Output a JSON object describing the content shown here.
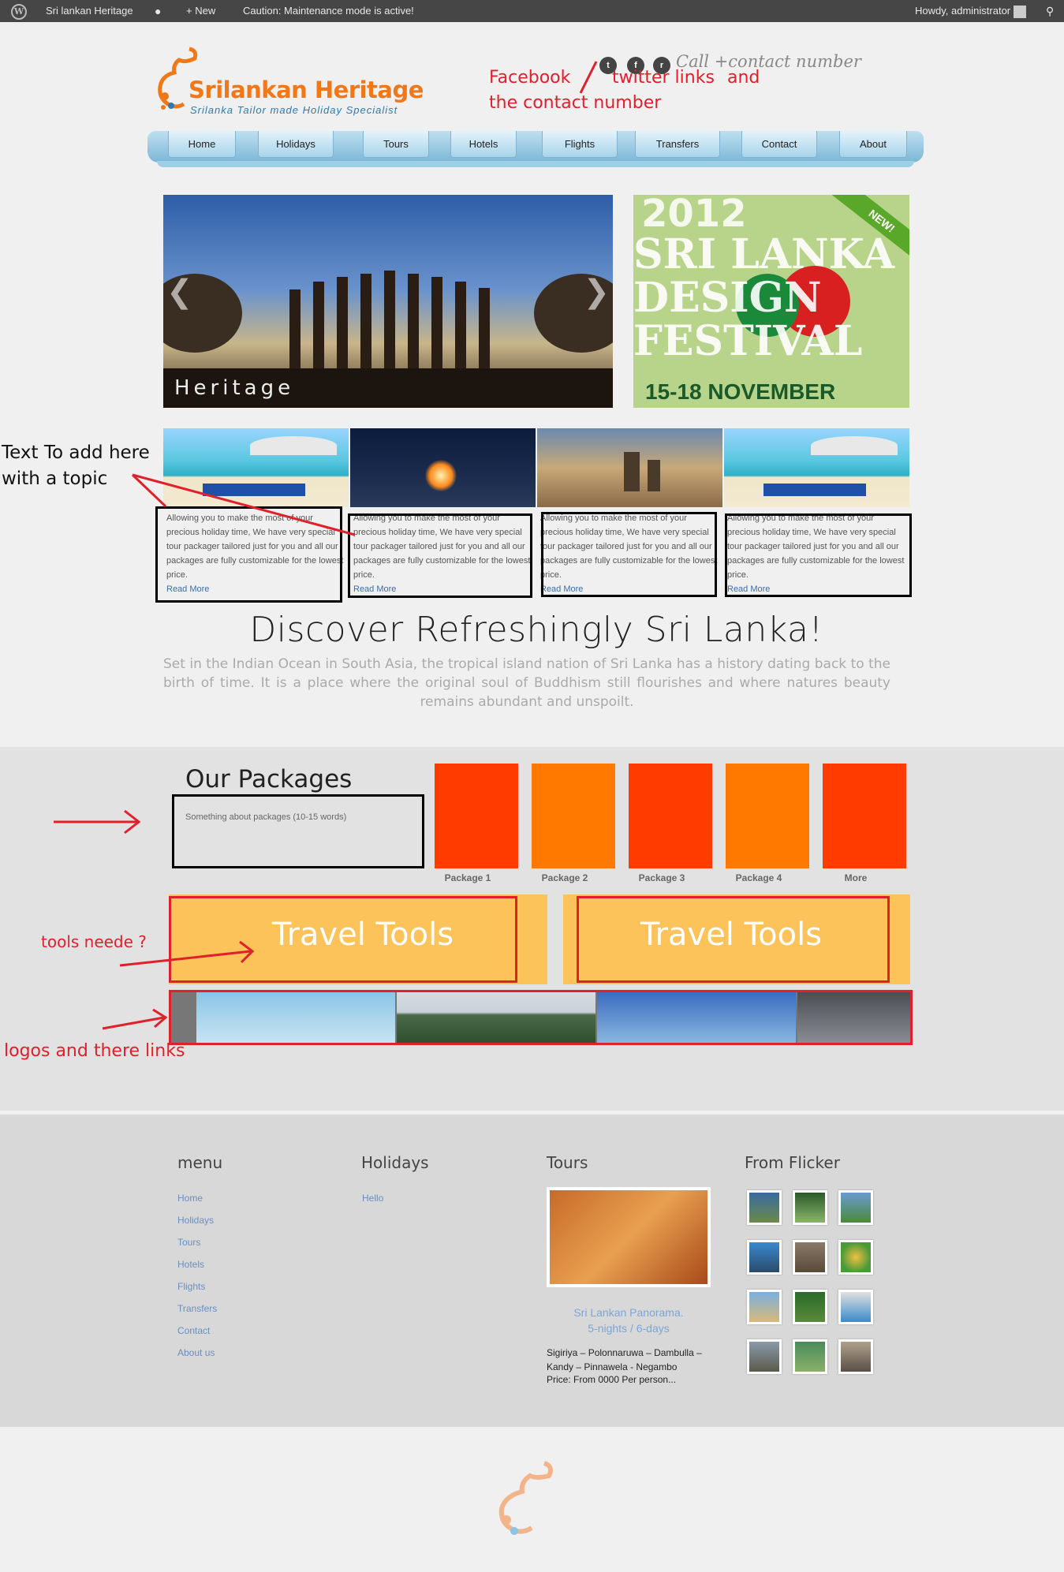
{
  "adminbar": {
    "site": "Sri lankan Heritage",
    "new": "New",
    "caution": "Caution: Maintenance mode is active!",
    "howdy": "Howdy, administrator"
  },
  "header": {
    "brand": "Srilankan Heritage",
    "tagline": "Srilanka Tailor made Holiday Specialist",
    "call": "Call +contact number",
    "annotation_social_1": "Facebook",
    "annotation_social_2": "twitter links",
    "annotation_social_3": "and",
    "annotation_social_4": "the contact number"
  },
  "nav": [
    "Home",
    "Holidays",
    "Tours",
    "Hotels",
    "Flights",
    "Transfers",
    "Contact",
    "About"
  ],
  "slider": {
    "caption": "Heritage"
  },
  "banner": {
    "year": "2012",
    "line1": "SRI LANKA",
    "line2": "DESIGN",
    "line3": "FESTIVAL",
    "dates": "15-18 NOVEMBER",
    "ribbon": "NEW!"
  },
  "annotation_text": [
    "Text To add here",
    "with a topic"
  ],
  "features": [
    {
      "text": "Allowing you to make the most of your precious holiday time, We have very special tour packager tailored just for you and all our packages are fully customizable for the lowest price.",
      "link": "Read More"
    },
    {
      "text": "Allowing you to make the most of your precious holiday time, We have very special tour packager tailored just for you and all our packages are fully customizable for the lowest price.",
      "link": "Read More"
    },
    {
      "text": "Allowing you to make the most of your precious holiday time, We have very special tour packager tailored just for you and all our packages are fully customizable for the lowest price.",
      "link": "Read More"
    },
    {
      "text": "Allowing you to make the most of your precious holiday time, We have very special tour packager tailored just for you and all our packages are fully customizable for the lowest price.",
      "link": "Read More"
    }
  ],
  "intro": {
    "title": "Discover Refreshingly Sri Lanka!",
    "text": "Set in the Indian Ocean in South Asia, the tropical island nation of Sri Lanka has a history dating back to the birth of time. It is a place where the original soul of Buddhism still flourishes and where natures beauty remains abundant and unspoilt."
  },
  "packages": {
    "title": "Our Packages",
    "desc": "Something about packages (10-15 words)",
    "items": [
      "Package 1",
      "Package 2",
      "Package 3",
      "Package 4",
      "More"
    ],
    "colors": [
      "#ff3b00",
      "#ff7800",
      "#ff3b00",
      "#ff7800",
      "#ff3b00"
    ]
  },
  "tools": {
    "label": "Travel Tools",
    "annotation": "tools neede ?"
  },
  "logos": {
    "annotation": "logos and there links"
  },
  "footer": {
    "menu_title": "menu",
    "menu": [
      "Home",
      "Holidays",
      "Tours",
      "Hotels",
      "Flights",
      "Transfers",
      "Contact",
      "About us"
    ],
    "holidays_title": "Holidays",
    "holidays_link": "Hello",
    "tours_title": "Tours",
    "tour_name": "Sri Lankan Panorama.",
    "tour_duration": "5-nights / 6-days",
    "tour_route": "Sigiriya – Polonnaruwa – Dambulla – Kandy – Pinnawela - Negambo",
    "tour_price": "Price:  From 0000 Per person...",
    "flickr_title": "From Flicker"
  }
}
